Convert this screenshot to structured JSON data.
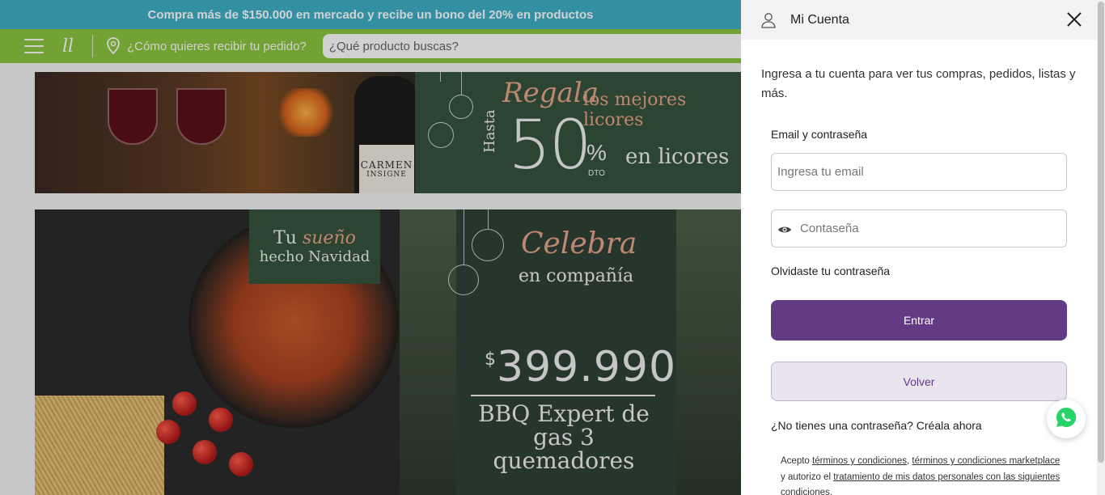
{
  "store": {
    "promo_bar": "Compra más de $150.000 en mercado y recibe un bono del 20% en productos",
    "delivery_prompt": "¿Cómo quieres recibir tu pedido?",
    "search_placeholder": "¿Qué producto buscas?",
    "logo_mark": "ll"
  },
  "banner_liquor": {
    "title_script": "Regala",
    "title_rest": "los mejores licores",
    "prefix": "Hasta",
    "discount": "50",
    "percent_sign": "%",
    "discount_suffix": "DTO",
    "category": "en licores",
    "bottle_label_line1": "CARMEN",
    "bottle_label_line2": "INSIGNE"
  },
  "banner_pasta": {
    "line1_a": "Tu",
    "line1_b": "sueño",
    "line2": "hecho Navidad"
  },
  "banner_bbq": {
    "title_script": "Celebra",
    "subtitle": "en compañía",
    "currency": "$",
    "price": "399.990",
    "product": "BBQ Expert de gas 3 quemadores"
  },
  "account_drawer": {
    "title": "Mi Cuenta",
    "intro": "Ingresa a tu cuenta para ver tus compras, pedidos, listas y más.",
    "section_label": "Email y contraseña",
    "email_placeholder": "Ingresa tu email",
    "password_placeholder": "Contaseña",
    "forgot_password": "Olvidaste tu contraseña",
    "submit_label": "Entrar",
    "back_label": "Volver",
    "signup_question": "¿No tienes una contraseña?",
    "signup_link": "Créala ahora",
    "terms": {
      "prefix": "Acepto",
      "link1": "términos y condiciones",
      "sep1": ",",
      "link2": "términos y condiciones marketplace",
      "middle": "y autorizo el",
      "link3": "tratamiento de mis datos personales con las siguientes condiciones",
      "suffix": "."
    }
  },
  "colors": {
    "promo_bar": "#3fb0c7",
    "nav_bar": "#8cc63f",
    "primary_button": "#633b84",
    "secondary_button": "#eae4ef",
    "banner_green": "#36533d",
    "accent_pink": "#e8a58a"
  },
  "icons": {
    "header_user": "user-icon",
    "close": "close-icon",
    "menu": "hamburger-menu-icon",
    "location": "location-pin-icon",
    "password_visibility": "eye-icon",
    "chat": "whatsapp-icon"
  }
}
